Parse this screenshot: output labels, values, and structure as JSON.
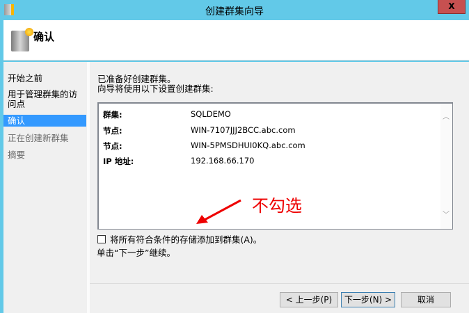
{
  "window": {
    "title": "创建群集向导",
    "close_label": "X"
  },
  "header": {
    "title": "确认"
  },
  "nav": {
    "items": [
      {
        "label": "开始之前"
      },
      {
        "label": "用于管理群集的访问点"
      },
      {
        "label": "确认"
      },
      {
        "label": "正在创建新群集"
      },
      {
        "label": "摘要"
      }
    ]
  },
  "content": {
    "intro_line1": "已准备好创建群集。",
    "intro_line2": "向导将使用以下设置创建群集:",
    "settings": [
      {
        "key": "群集:",
        "value": "SQLDEMO"
      },
      {
        "key": "节点:",
        "value": "WIN-7107JJJ2BCC.abc.com"
      },
      {
        "key": "节点:",
        "value": "WIN-5PMSDHUI0KQ.abc.com"
      },
      {
        "key": "IP 地址:",
        "value": "192.168.66.170"
      }
    ],
    "checkbox_label": "将所有符合条件的存储添加到群集(A)。",
    "checkbox_checked": false,
    "hint": "单击“下一步”继续。"
  },
  "annotation": {
    "text": "不勾选",
    "color": "#e00000"
  },
  "buttons": {
    "prev": "< 上一步(P)",
    "next": "下一步(N) >",
    "cancel": "取消"
  }
}
